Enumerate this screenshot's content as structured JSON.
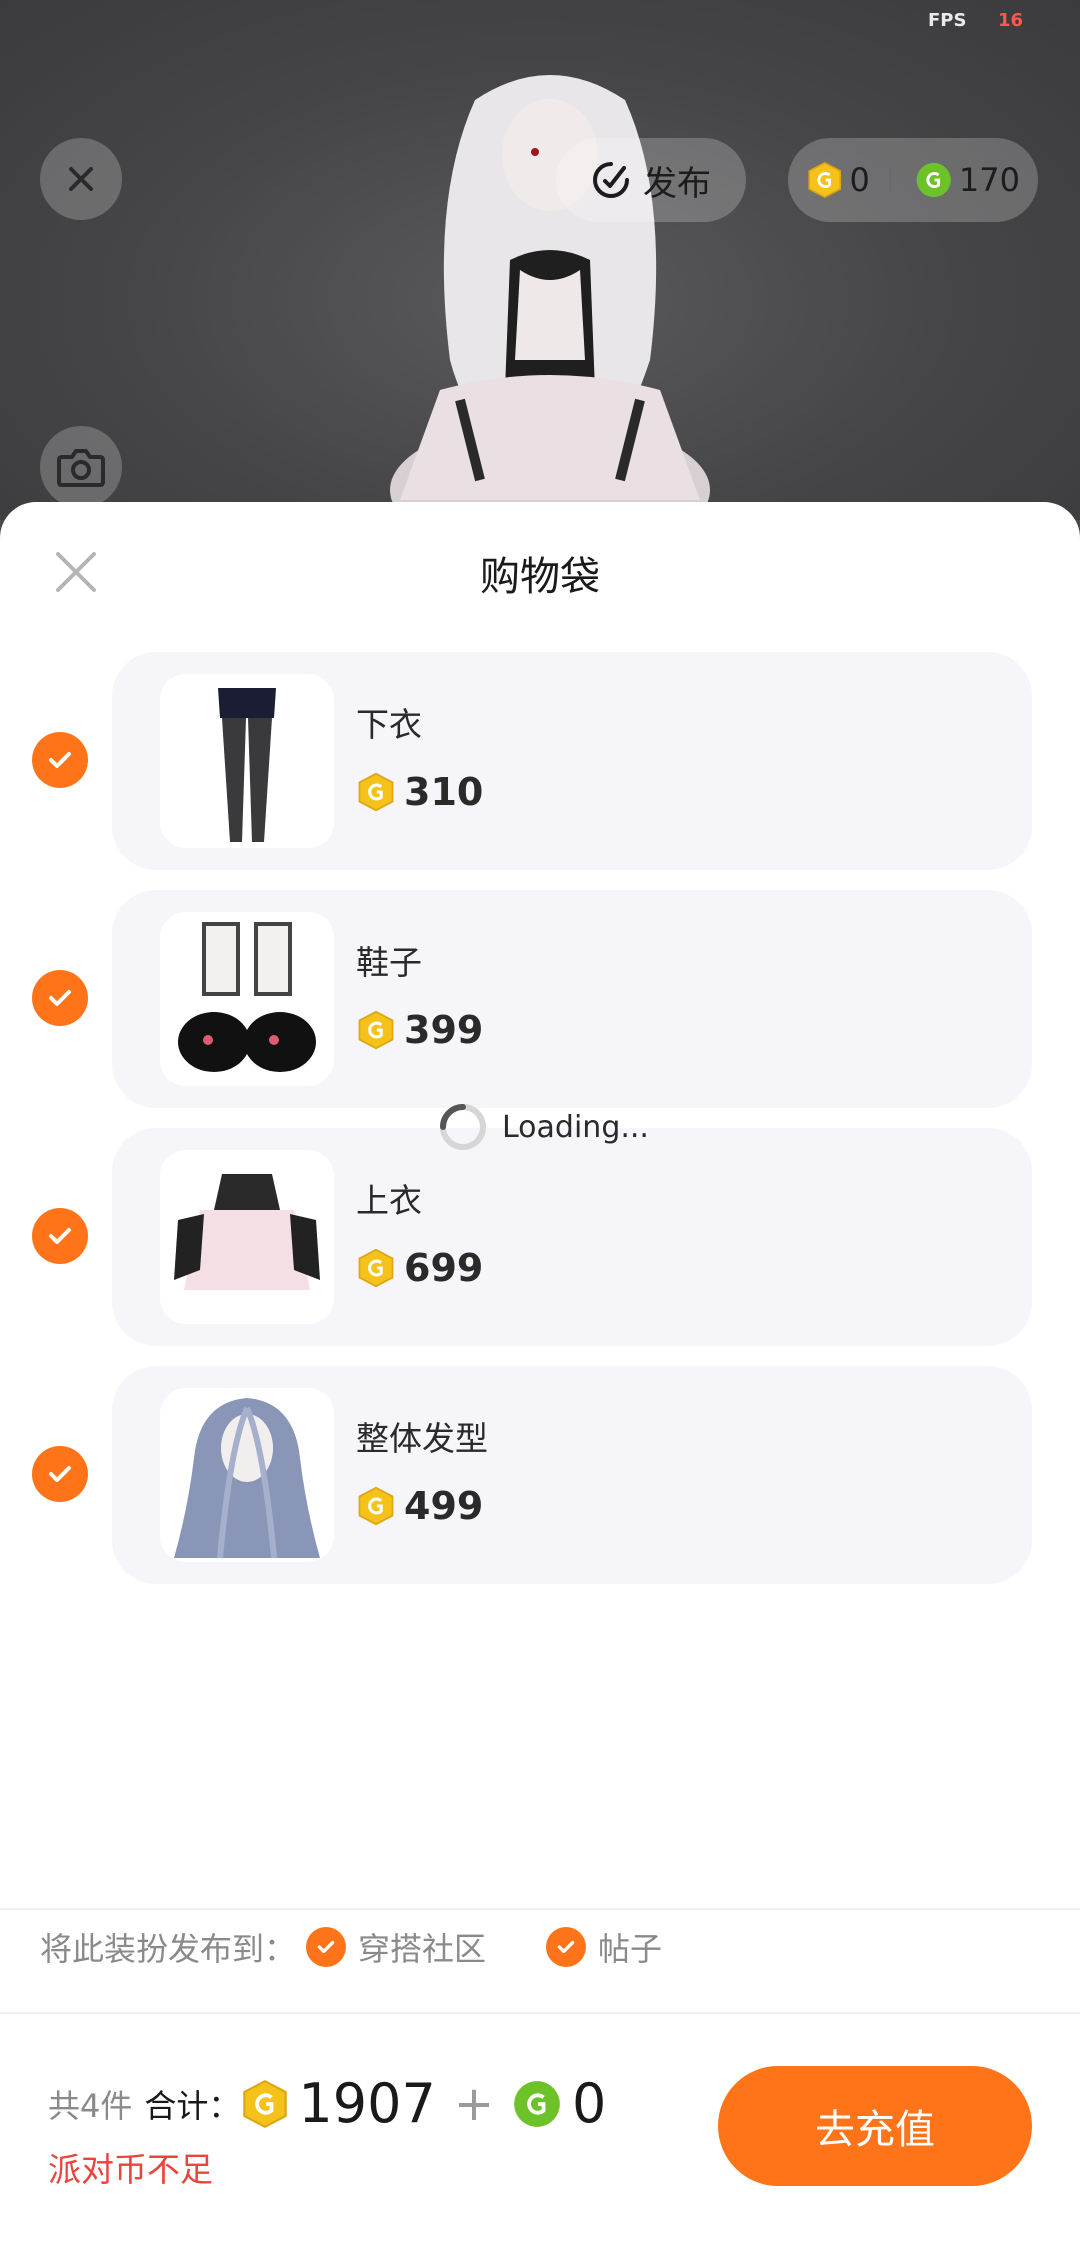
{
  "hud": {
    "fps_label": "FPS",
    "fps_value": "16",
    "publish_label": "发布",
    "gold_coins": "0",
    "green_coins": "170"
  },
  "sheet": {
    "title": "购物袋",
    "items": [
      {
        "name": "下衣",
        "price": "310"
      },
      {
        "name": "鞋子",
        "price": "399"
      },
      {
        "name": "上衣",
        "price": "699"
      },
      {
        "name": "整体发型",
        "price": "499"
      }
    ],
    "loading_text": "Loading..."
  },
  "publish_to": {
    "label": "将此装扮发布到：",
    "options": [
      "穿搭社区",
      "帖子"
    ]
  },
  "footer": {
    "count_text": "共4件",
    "total_label": "合计：",
    "gold_total": "1907",
    "plus": "+",
    "green_total": "0",
    "warning": "派对币不足",
    "recharge_label": "去充值"
  },
  "colors": {
    "accent": "#ff7418",
    "warning": "#e8453c",
    "gold_coin": "#f5c21a",
    "green_coin": "#6dc22a"
  }
}
